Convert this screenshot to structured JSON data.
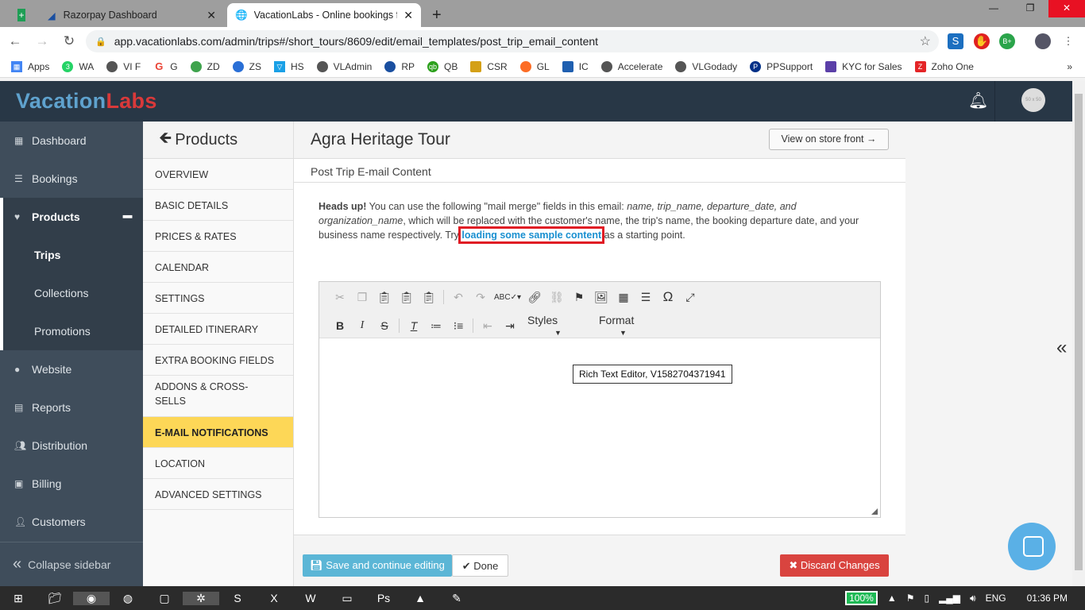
{
  "browser": {
    "tabs": [
      {
        "label": "Razorpay Dashboard"
      },
      {
        "label": "VacationLabs - Online bookings f"
      }
    ],
    "url": "app.vacationlabs.com/admin/trips#/short_tours/8609/edit/email_templates/post_trip_email_content",
    "bookmarks": [
      "Apps",
      "WA",
      "VI F",
      "G",
      "ZD",
      "ZS",
      "HS",
      "VLAdmin",
      "RP",
      "QB",
      "CSR",
      "GL",
      "IC",
      "Accelerate",
      "VLGodady",
      "PPSupport",
      "KYC for Sales",
      "Zoho One"
    ]
  },
  "header": {
    "logo_a": "Vacation",
    "logo_b": "Labs",
    "avatar": "50 x 50"
  },
  "sidebar": {
    "items": [
      {
        "label": "Dashboard",
        "icon": "calendar-icon"
      },
      {
        "label": "Bookings",
        "icon": "list-icon"
      },
      {
        "label": "Products",
        "icon": "map-marker-icon"
      },
      {
        "label": "Trips"
      },
      {
        "label": "Collections"
      },
      {
        "label": "Promotions"
      },
      {
        "label": "Website",
        "icon": "globe-icon"
      },
      {
        "label": "Reports",
        "icon": "file-icon"
      },
      {
        "label": "Distribution",
        "icon": "users-icon"
      },
      {
        "label": "Billing",
        "icon": "money-icon"
      },
      {
        "label": "Customers",
        "icon": "user-icon"
      }
    ],
    "collapse": "Collapse sidebar"
  },
  "subnav": {
    "title": "Products",
    "items": [
      "OVERVIEW",
      "BASIC DETAILS",
      "PRICES & RATES",
      "CALENDAR",
      "SETTINGS",
      "DETAILED ITINERARY",
      "EXTRA BOOKING FIELDS",
      "ADDONS & CROSS-SELLS",
      "E-MAIL NOTIFICATIONS",
      "LOCATION",
      "ADVANCED SETTINGS"
    ],
    "active": "E-MAIL NOTIFICATIONS"
  },
  "main": {
    "title": "Agra Heritage Tour",
    "store_button": "View on store front →",
    "section": "Post Trip E-mail Content",
    "note": {
      "bold": "Heads up!",
      "t1": " You can use the following \"mail merge\" fields in this email: ",
      "fields": "name, trip_name, departure_date, and organization_name",
      "t2": ", which will be replaced with the customer's name, the trip's name, the booking departure date, and your business name respectively. Try ",
      "link": "loading some sample content",
      "t3": " as a starting point."
    },
    "editor": {
      "styles": "Styles",
      "format": "Format",
      "tooltip": "Rich Text Editor, V1582704371941"
    },
    "save": "Save and continue editing",
    "done": "Done",
    "discard": "Discard Changes"
  },
  "taskbar": {
    "battery": "100%",
    "lang": "ENG",
    "time": "01:36 PM"
  },
  "colors": {
    "header": "#283746",
    "sidebar": "#3f4d5b",
    "active_subnav": "#fdd757",
    "save": "#5bb6d6",
    "discard": "#d9443f",
    "link": "#1a8fd0"
  }
}
